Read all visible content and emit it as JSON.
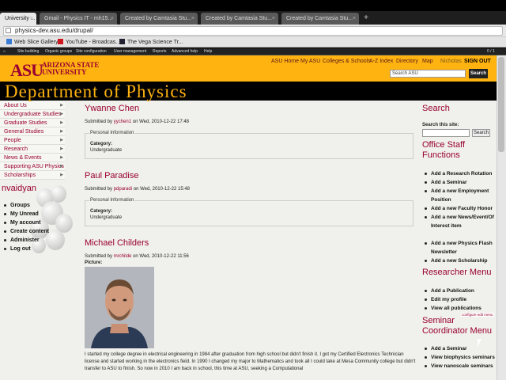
{
  "browser": {
    "tabs": [
      {
        "label": "University ..."
      },
      {
        "label": "Gmail - Physics IT - mh15..."
      },
      {
        "label": "Created by Camtasia Stu..."
      },
      {
        "label": "Created by Camtasia Stu..."
      },
      {
        "label": "Created by Camtasia Stu..."
      }
    ],
    "url": "physics-dev.asu.edu/drupal/",
    "bookmarks": [
      {
        "label": "Web Slice Gallery"
      },
      {
        "label": "YouTube - Broadcas..."
      },
      {
        "label": "The Vega Science Tr..."
      }
    ]
  },
  "admin_bar": [
    "Site building",
    "Organic groups",
    "Site configuration",
    "User management",
    "Reports",
    "Advanced help",
    "Help"
  ],
  "admin_counter": "0 / 1",
  "asu_header": {
    "logo": "ASU",
    "name_line1": "ARIZONA STATE",
    "name_line2": "UNIVERSITY",
    "nav": [
      "ASU Home",
      "My ASU",
      "Colleges & Schools",
      "A-Z Index",
      "Directory",
      "Map"
    ],
    "user": "Nicholas",
    "signout": "SIGN OUT",
    "search_placeholder": "Search ASU",
    "search_button": "Search"
  },
  "dept_title": "Department of Physics",
  "left_nav": [
    "About Us",
    "Undergraduate Studies",
    "Graduate Studies",
    "General Studies",
    "People",
    "Research",
    "News & Events",
    "Supporting ASU Physics",
    "Scholarships"
  ],
  "user_block": {
    "username": "nvaidyan",
    "links": [
      "Groups",
      "My Unread",
      "My account",
      "Create content",
      "Administer",
      "Log out"
    ]
  },
  "posts": [
    {
      "title": "Ywanne Chen",
      "submitted_prefix": "Submitted by",
      "author": "yychen1",
      "date": "on Wed, 2010-12-22 17:48",
      "legend": "Personal Information",
      "category_label": "Category:",
      "category": "Undergraduate"
    },
    {
      "title": "Paul Paradise",
      "submitted_prefix": "Submitted by",
      "author": "pdparadi",
      "date": "on Wed, 2010-12-22 15:48",
      "legend": "Personal Information",
      "category_label": "Category:",
      "category": "Undergraduate"
    },
    {
      "title": "Michael Childers",
      "submitted_prefix": "Submitted by",
      "author": "mrchilde",
      "date": "on Wed, 2010-12-22 11:56",
      "picture_label": "Picture:",
      "bio": "I started my college degree in electrical engineering in 1984 after graduation from high school but didn't finish it. I got my Certified Electronics Technician license and started working in the electronics field. In 1990 I changed my major to Mathematics and took all I could take at Mesa Community college but didn't transfer to ASU to finish. So now in 2010 I am back in school, this time at ASU, seeking a Computational"
    }
  ],
  "right_sidebar": {
    "search_title": "Search",
    "search_label": "Search this site:",
    "search_button": "Search",
    "office_staff_title": "Office Staff Functions",
    "office_staff_links": [
      "Add a Research Rotation",
      "Add a Seminar",
      "Add a new Employment Position",
      "Add a new Faculty Honor",
      "Add a new News/Event/Of Interest item",
      "Add a new Physics Flash Newsletter",
      "Add a new Scholarship"
    ],
    "researcher_title": "Researcher Menu",
    "researcher_links": [
      "Add a Publication",
      "Edit my profile",
      "View all publications"
    ],
    "configure_label": "configure edit menu",
    "seminar_title": "Seminar Coordinator Menu",
    "seminar_links": [
      "Add a Seminar",
      "View biophysics seminars",
      "View nanoscale seminars"
    ]
  },
  "colors": {
    "asu_maroon": "#990033",
    "asu_gold": "#ffb310"
  }
}
